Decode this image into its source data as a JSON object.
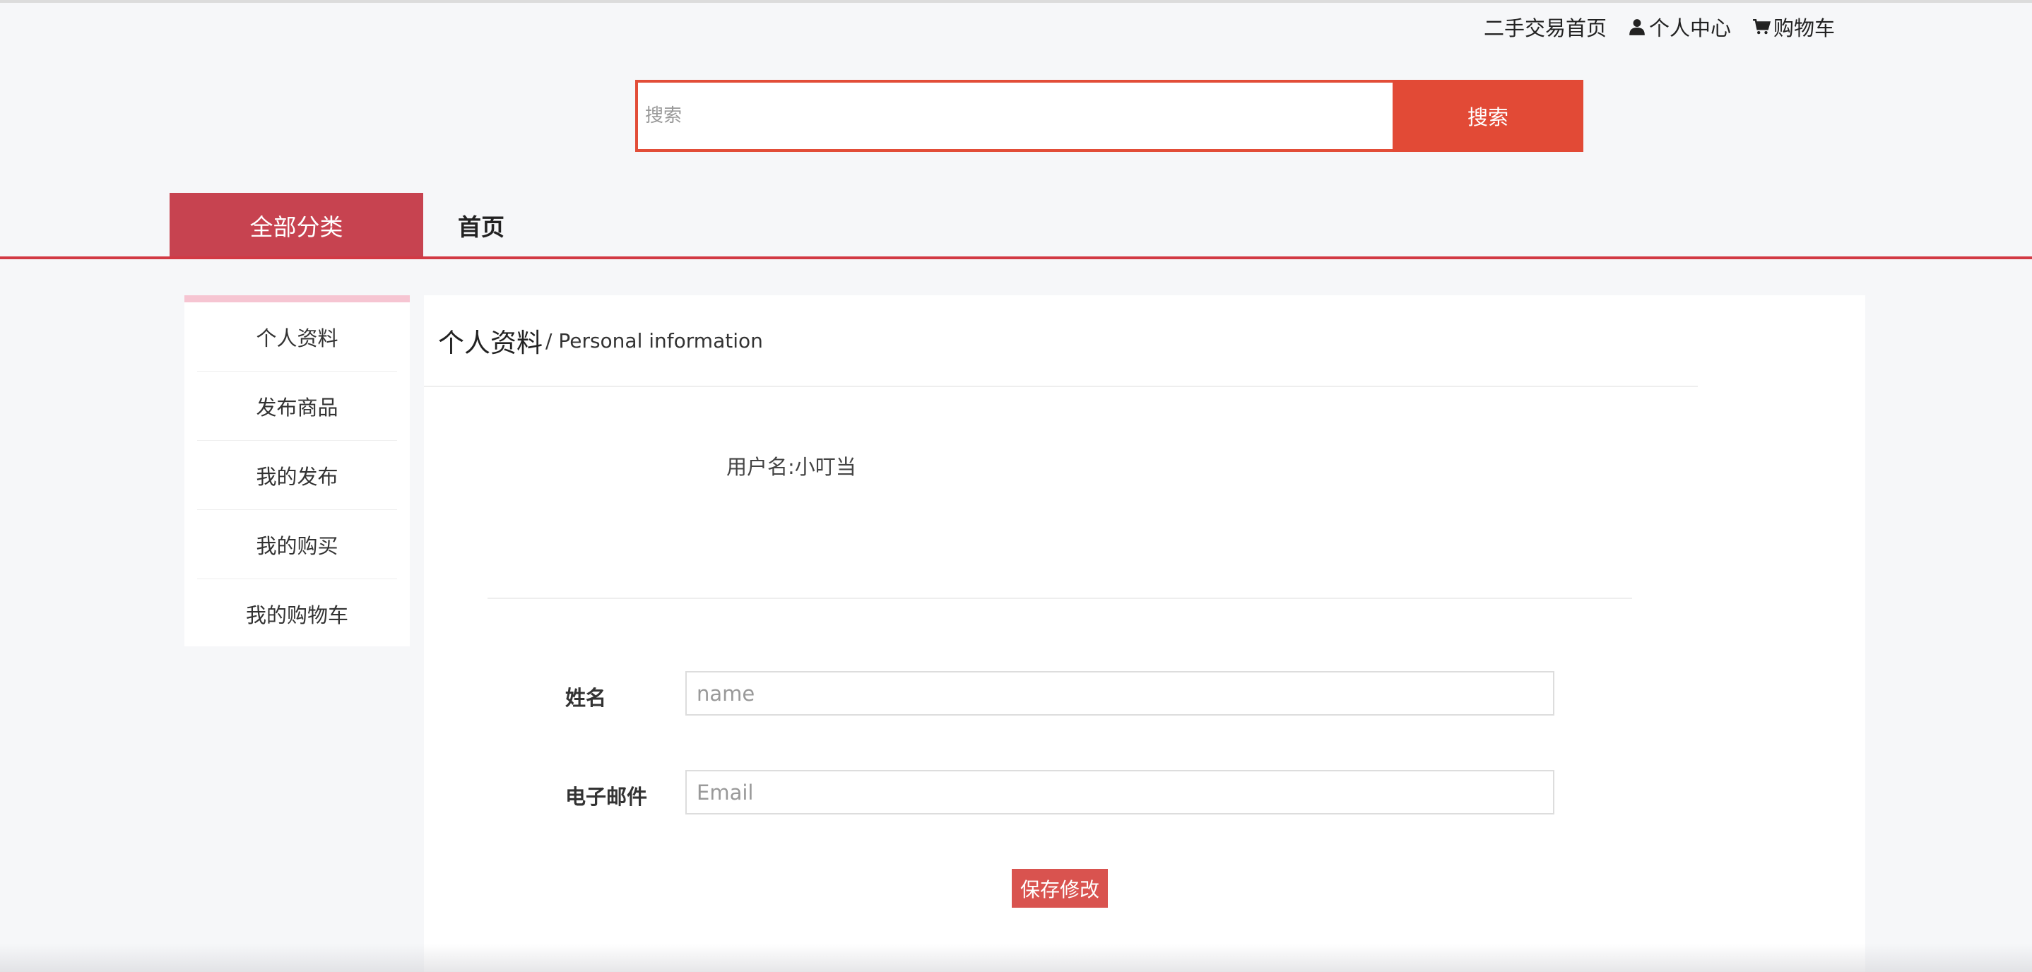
{
  "header": {
    "links": [
      {
        "label": "二手交易首页",
        "icon": ""
      },
      {
        "label": "个人中心",
        "icon": "user-icon"
      },
      {
        "label": "购物车",
        "icon": "shopping-cart-icon"
      }
    ]
  },
  "search": {
    "placeholder": "搜索",
    "value": "",
    "button_label": "搜索"
  },
  "nav": {
    "all_categories": "全部分类",
    "home": "首页"
  },
  "sidebar": {
    "items": [
      {
        "label": "个人资料"
      },
      {
        "label": "发布商品"
      },
      {
        "label": "我的发布"
      },
      {
        "label": "我的购买"
      },
      {
        "label": "我的购物车"
      }
    ]
  },
  "profile": {
    "title": "个人资料",
    "subtitle": "/ Personal information",
    "username_label": "用户名:",
    "username_value": "小叮当",
    "form": {
      "name_label": "姓名",
      "name_placeholder": "name",
      "name_value": "",
      "email_label": "电子邮件",
      "email_placeholder": "Email",
      "email_value": "",
      "save_label": "保存修改"
    }
  },
  "colors": {
    "accent": "#e24a36",
    "nav_primary": "#c74350",
    "nav_line": "#d23a44",
    "sidebar_top": "#f6c5d2",
    "save_button": "#d9534f",
    "background": "#f6f7f9"
  }
}
